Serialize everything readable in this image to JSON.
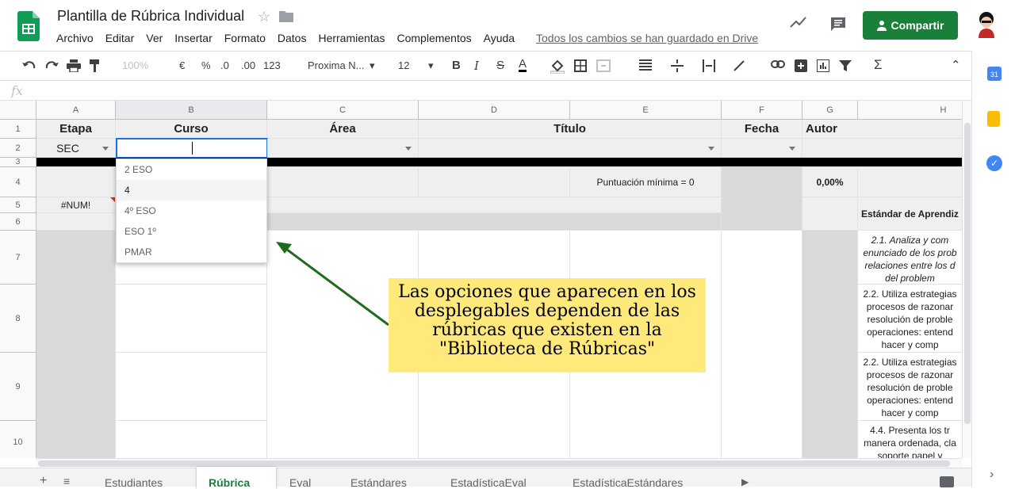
{
  "doc": {
    "title": "Plantilla de Rúbrica Individual",
    "save_status": "Todos los cambios se han guardado en Drive"
  },
  "menu": [
    "Archivo",
    "Editar",
    "Ver",
    "Insertar",
    "Formato",
    "Datos",
    "Herramientas",
    "Complementos",
    "Ayuda"
  ],
  "share": {
    "label": "Compartir"
  },
  "toolbar": {
    "zoom": "100%",
    "currency": "€",
    "percent": "%",
    "dec_less": ".0",
    "dec_more": ".00",
    "format": "123",
    "font": "Proxima N...",
    "size": "12"
  },
  "columns": [
    "A",
    "B",
    "C",
    "D",
    "E",
    "F",
    "G",
    "H"
  ],
  "rows": [
    "1",
    "2",
    "3",
    "4",
    "5",
    "6",
    "7",
    "8",
    "9",
    "10"
  ],
  "headers": {
    "etapa": "Etapa",
    "curso": "Curso",
    "area": "Área",
    "titulo": "Título",
    "fecha": "Fecha",
    "autor": "Autor"
  },
  "values": {
    "etapa": "SEC",
    "puntuacion": "Puntuación mínima = 0",
    "percent": "0,00%",
    "num_error": "#NUM!",
    "estandar_hdr": "Estándar de Aprendiz"
  },
  "h_cells": {
    "r7": "2.1. Analiza y com enunciado de los prob relaciones entre los d del problem",
    "r8": "2.2. Utiliza estrategias procesos de razonar resolución de proble operaciones: entend hacer y comp",
    "r9": "2.2. Utiliza estrategias procesos de razonar resolución de proble operaciones: entend hacer y comp",
    "r10": "4.4. Presenta los tr manera ordenada, cla soporte papel y"
  },
  "dropdown_options": [
    "2 ESO",
    "4",
    "4º ESO",
    "ESO 1º",
    "PMAR"
  ],
  "callout": "Las opciones que aparecen en los desplegables dependen de las rúbricas que existen en la \"Biblioteca de Rúbricas\"",
  "tabs": [
    "Estudiantes",
    "Rúbrica",
    "Eval",
    "Estándares",
    "EstadísticaEval",
    "EstadísticaEstándares"
  ],
  "active_tab": "Rúbrica",
  "colors": {
    "share": "#188038",
    "active_tab": "#188038",
    "callout": "#ffe97a",
    "arrow": "#1e6b1e"
  }
}
